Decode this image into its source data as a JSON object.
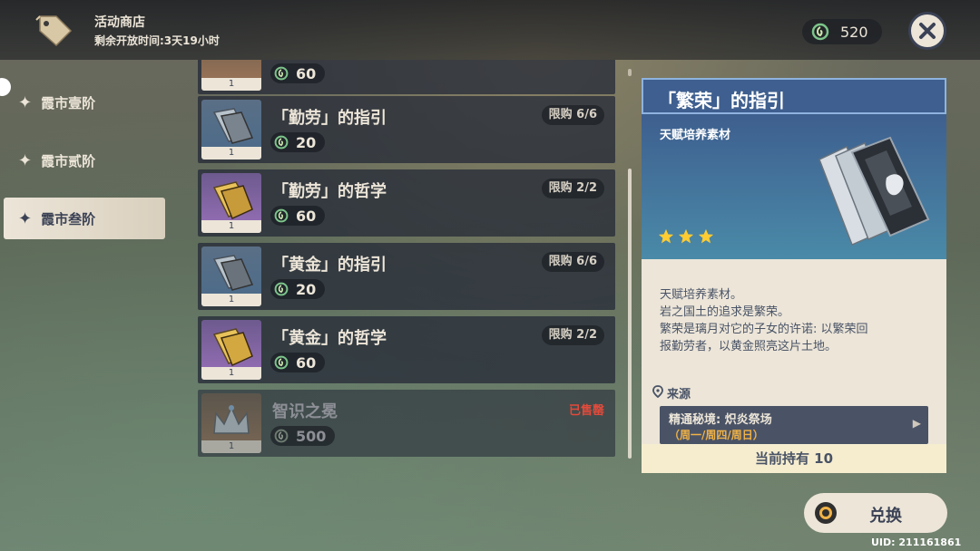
{
  "header": {
    "title": "活动商店",
    "time_remaining": "剩余开放时间:3天19小时",
    "currency_amount": "520"
  },
  "sidebar": {
    "tabs": [
      {
        "label": "霞市壹阶",
        "active": false
      },
      {
        "label": "霞市贰阶",
        "active": false
      },
      {
        "label": "霞市叁阶",
        "active": true
      }
    ]
  },
  "list": {
    "partial_item": {
      "price": "60",
      "count": "1"
    },
    "items": [
      {
        "name": "「勤劳」的指引",
        "price": "20",
        "limit": "限购 6/6",
        "count": "1",
        "rarity_color": "blue"
      },
      {
        "name": "「勤劳」的哲学",
        "price": "60",
        "limit": "限购 2/2",
        "count": "1",
        "rarity_color": "purple"
      },
      {
        "name": "「黄金」的指引",
        "price": "20",
        "limit": "限购 6/6",
        "count": "1",
        "rarity_color": "blue"
      },
      {
        "name": "「黄金」的哲学",
        "price": "60",
        "limit": "限购 2/2",
        "count": "1",
        "rarity_color": "purple"
      },
      {
        "name": "智识之冕",
        "price": "500",
        "status": "已售罄",
        "count": "1",
        "rarity_color": "orange"
      }
    ]
  },
  "detail": {
    "title": "「繁荣」的指引",
    "category": "天赋培养素材",
    "stars": 3,
    "description": [
      "天赋培养素材。",
      "岩之国土的追求是繁荣。",
      "繁荣是璃月对它的子女的许诺: 以繁荣回",
      "报勤劳者，以黄金照亮这片土地。"
    ],
    "source_label": "来源",
    "source_name": "精通秘境: 炽炎祭场",
    "source_days": "（周一/周四/周日）",
    "owned_text": "当前持有 10"
  },
  "exchange_button": {
    "label": "兑换"
  },
  "uid": "UID: 211161861",
  "colors": {
    "accent_gold": "#f0b247",
    "panel_blue": "#3e5f8f",
    "soldout_red": "#e24a3b",
    "cream": "#ece5d8"
  }
}
